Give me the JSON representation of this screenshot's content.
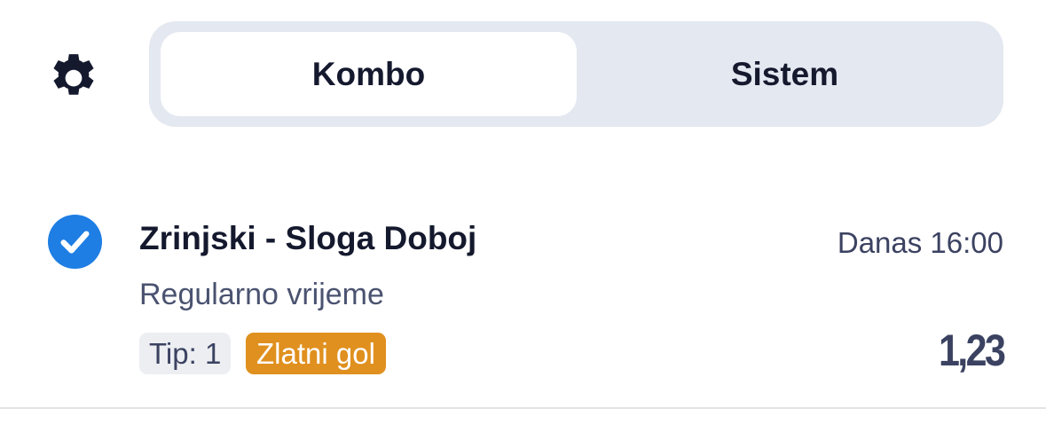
{
  "header": {
    "settings_icon": "gear-icon",
    "tabs": [
      {
        "label": "Kombo",
        "active": true
      },
      {
        "label": "Sistem",
        "active": false
      }
    ]
  },
  "bet": {
    "selected_icon": "check-circle-icon",
    "match": "Zrinjski - Sloga Doboj",
    "time": "Danas 16:00",
    "market": "Regularno vrijeme",
    "tip": "Tip: 1",
    "badge": "Zlatni gol",
    "odds": "1,23"
  },
  "colors": {
    "accent_blue": "#1e7ee4",
    "gold_badge": "#e0901e",
    "segment_bg": "#e4e8f0",
    "text_dark": "#15192e"
  }
}
